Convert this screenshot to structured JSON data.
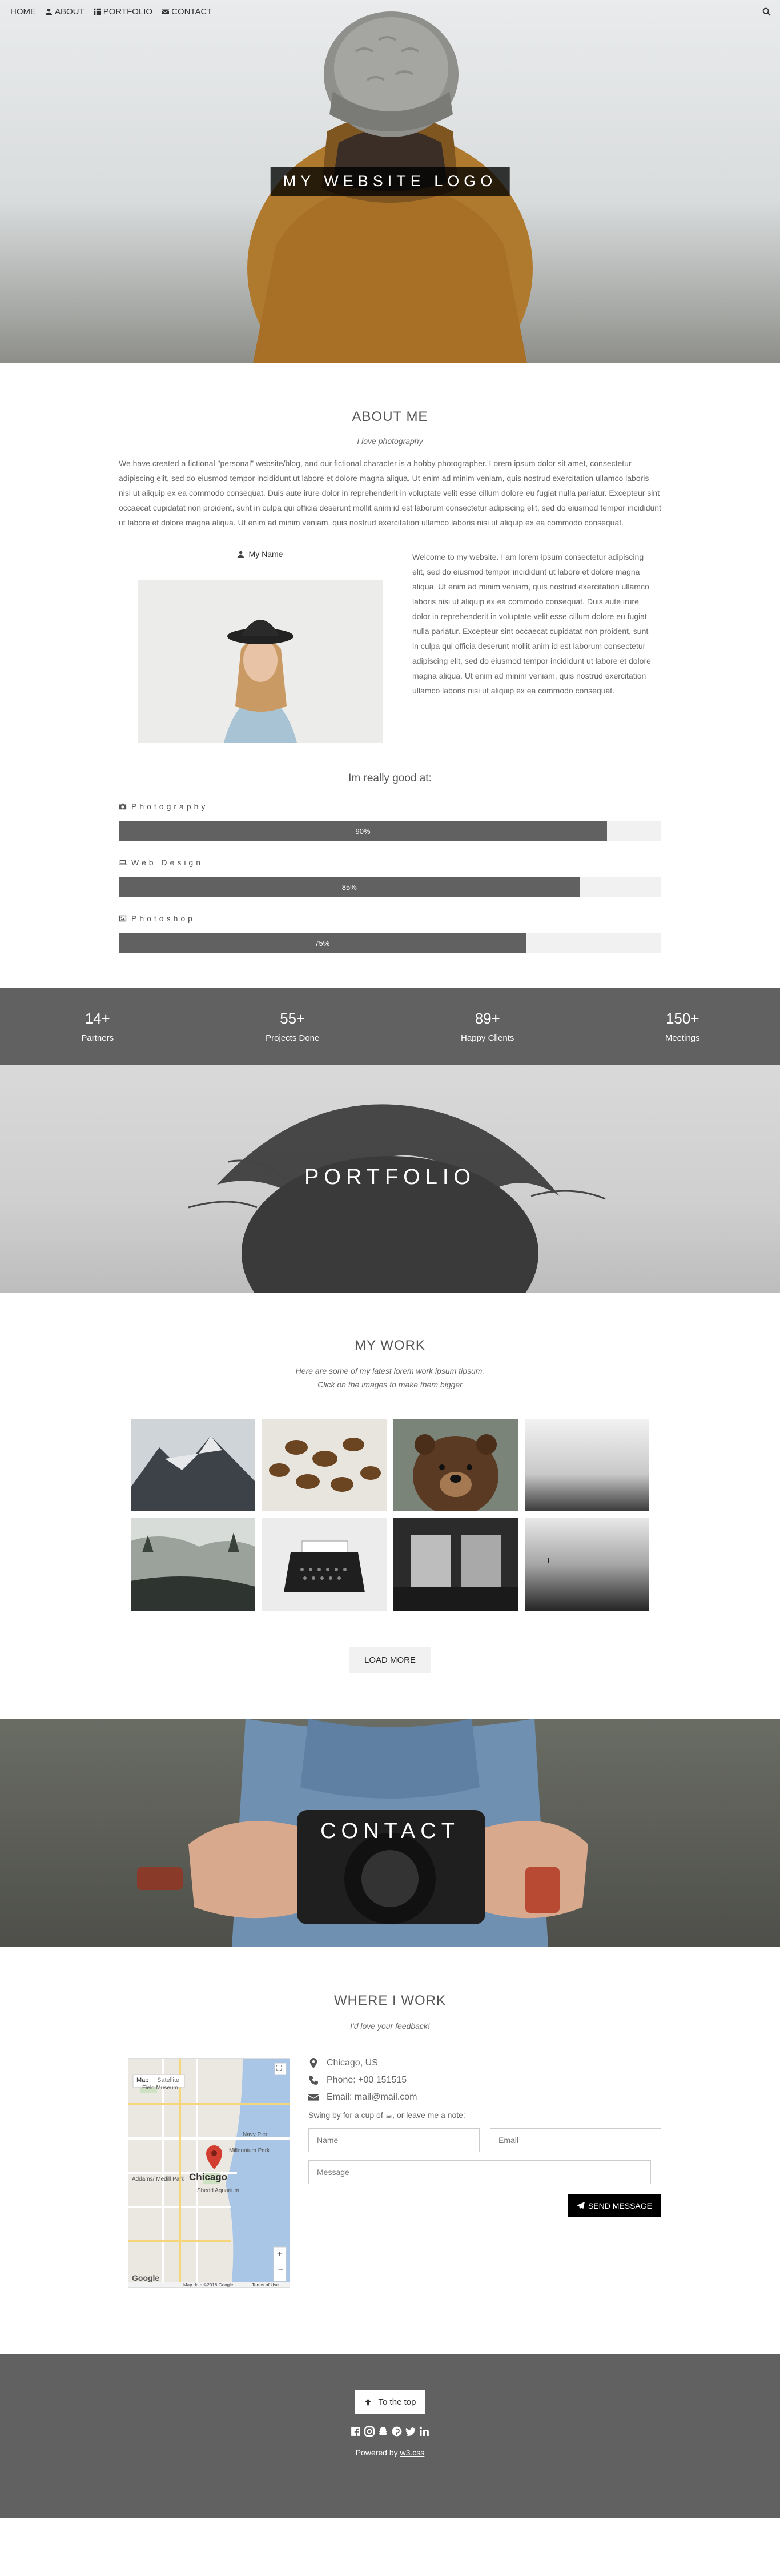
{
  "nav": {
    "items": [
      {
        "label": "HOME",
        "icon": ""
      },
      {
        "label": "ABOUT",
        "icon": "user-icon"
      },
      {
        "label": "PORTFOLIO",
        "icon": "th-icon"
      },
      {
        "label": "CONTACT",
        "icon": "envelope-icon"
      }
    ],
    "search_icon": "search-icon"
  },
  "hero": {
    "logo_text": "MY WEBSITE LOGO"
  },
  "about": {
    "title": "ABOUT ME",
    "subtitle": "I love photography",
    "text": "We have created a fictional \"personal\" website/blog, and our fictional character is a hobby photographer. Lorem ipsum dolor sit amet, consectetur adipiscing elit, sed do eiusmod tempor incididunt ut labore et dolore magna aliqua. Ut enim ad minim veniam, quis nostrud exercitation ullamco laboris nisi ut aliquip ex ea commodo consequat. Duis aute irure dolor in reprehenderit in voluptate velit esse cillum dolore eu fugiat nulla pariatur. Excepteur sint occaecat cupidatat non proident, sunt in culpa qui officia deserunt mollit anim id est laborum consectetur adipiscing elit, sed do eiusmod tempor incididunt ut labore et dolore magna aliqua. Ut enim ad minim veniam, quis nostrud exercitation ullamco laboris nisi ut aliquip ex ea commodo consequat.",
    "name": "My Name",
    "welcome": "Welcome to my website. I am lorem ipsum consectetur adipiscing elit, sed do eiusmod tempor incididunt ut labore et dolore magna aliqua. Ut enim ad minim veniam, quis nostrud exercitation ullamco laboris nisi ut aliquip ex ea commodo consequat. Duis aute irure dolor in reprehenderit in voluptate velit esse cillum dolore eu fugiat nulla pariatur. Excepteur sint occaecat cupidatat non proident, sunt in culpa qui officia deserunt mollit anim id est laborum consectetur adipiscing elit, sed do eiusmod tempor incididunt ut labore et dolore magna aliqua. Ut enim ad minim veniam, quis nostrud exercitation ullamco laboris nisi ut aliquip ex ea commodo consequat.",
    "skills_title": "Im really good at:",
    "skills": [
      {
        "label": "Photography",
        "value": 90,
        "value_label": "90%",
        "icon": "camera-icon"
      },
      {
        "label": "Web Design",
        "value": 85,
        "value_label": "85%",
        "icon": "laptop-icon"
      },
      {
        "label": "Photoshop",
        "value": 75,
        "value_label": "75%",
        "icon": "photo-icon"
      }
    ]
  },
  "stats": [
    {
      "num": "14+",
      "label": "Partners"
    },
    {
      "num": "55+",
      "label": "Projects Done"
    },
    {
      "num": "89+",
      "label": "Happy Clients"
    },
    {
      "num": "150+",
      "label": "Meetings"
    }
  ],
  "portfolio": {
    "banner": "PORTFOLIO",
    "title": "MY WORK",
    "subtitle1": "Here are some of my latest lorem work ipsum tipsum.",
    "subtitle2": "Click on the images to make them bigger",
    "load_more": "LOAD MORE"
  },
  "contact": {
    "banner": "CONTACT",
    "title": "WHERE I WORK",
    "subtitle": "I'd love your feedback!",
    "location": "Chicago, US",
    "phone": "Phone: +00 151515",
    "email": "Email: mail@mail.com",
    "note": "Swing by for a cup of ☕, or leave me a note:",
    "name_placeholder": "Name",
    "email_placeholder": "Email",
    "message_placeholder": "Message",
    "send": "SEND MESSAGE",
    "map": {
      "city": "Chicago",
      "tab_map": "Map",
      "tab_satellite": "Satellite",
      "places": [
        "Field Museum",
        "Navy Pier",
        "Millennium Park",
        "Shedd Aquarium",
        "Addams/ Medill Park"
      ],
      "attribution": "Map data ©2018 Google",
      "terms": "Terms of Use",
      "google": "Google"
    }
  },
  "footer": {
    "to_top": "To the top",
    "powered_prefix": "Powered by ",
    "powered_link": "w3.css"
  }
}
